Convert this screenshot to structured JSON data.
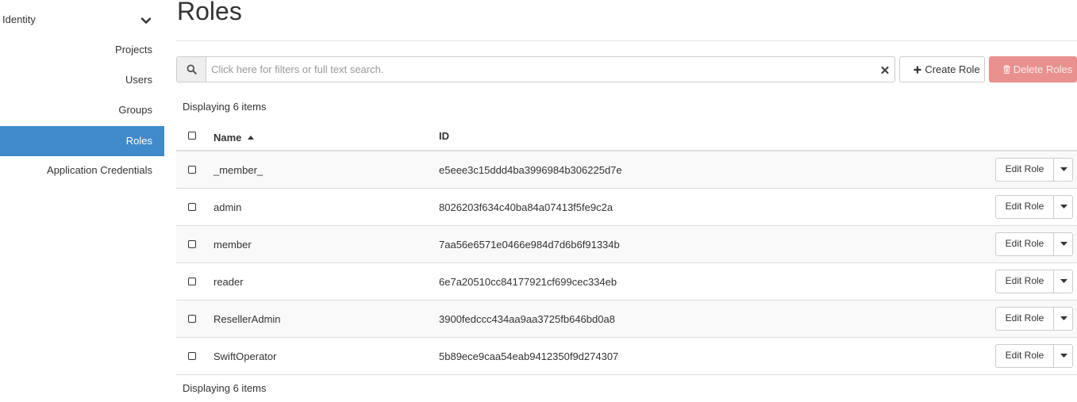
{
  "sidebar": {
    "section_label": "Identity",
    "items": [
      {
        "label": "Projects",
        "active": false
      },
      {
        "label": "Users",
        "active": false
      },
      {
        "label": "Groups",
        "active": false
      },
      {
        "label": "Roles",
        "active": true
      },
      {
        "label": "Application Credentials",
        "active": false
      }
    ]
  },
  "page": {
    "title": "Roles"
  },
  "search": {
    "placeholder": "Click here for filters or full text search.",
    "value": ""
  },
  "toolbar": {
    "create_label": "Create Role",
    "delete_label": "Delete Roles"
  },
  "table": {
    "count_top": "Displaying 6 items",
    "count_bottom": "Displaying 6 items",
    "columns": {
      "name": "Name",
      "id": "ID"
    },
    "row_action_label": "Edit Role",
    "rows": [
      {
        "name": "_member_",
        "id": "e5eee3c15ddd4ba3996984b306225d7e"
      },
      {
        "name": "admin",
        "id": "8026203f634c40ba84a07413f5fe9c2a"
      },
      {
        "name": "member",
        "id": "7aa56e6571e0466e984d7d6b6f91334b"
      },
      {
        "name": "reader",
        "id": "6e7a20510cc84177921cf699cec334eb"
      },
      {
        "name": "ResellerAdmin",
        "id": "3900fedccc434aa9aa3725fb646bd0a8"
      },
      {
        "name": "SwiftOperator",
        "id": "5b89ece9caa54eab9412350f9d274307"
      }
    ]
  },
  "colors": {
    "active_nav": "#3f8acb",
    "delete_button": "#e8918f"
  },
  "icons": {
    "sidebar_toggle": "chevron-down-icon",
    "search": "search-icon",
    "clear": "close-icon",
    "create": "plus-icon",
    "delete": "trash-icon",
    "sort": "sort-asc-icon",
    "row_dropdown": "caret-down-icon"
  }
}
